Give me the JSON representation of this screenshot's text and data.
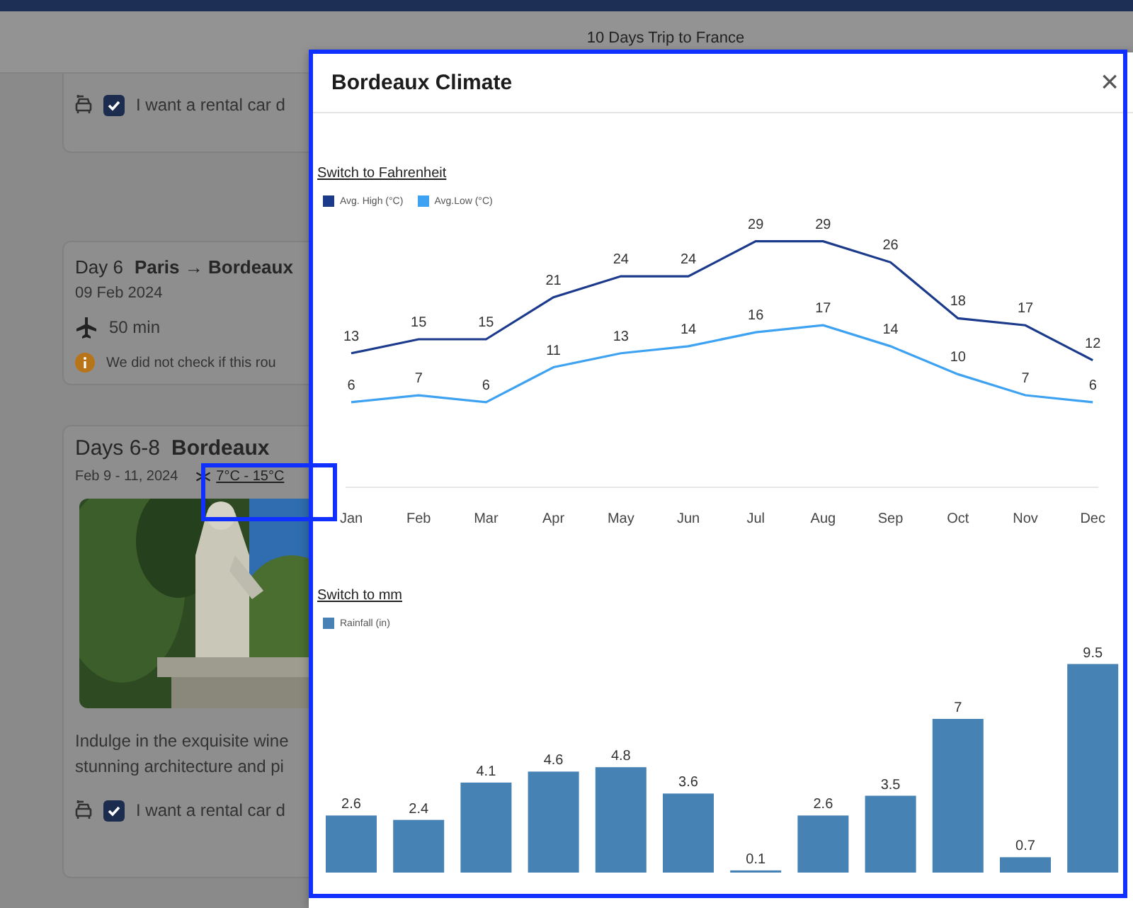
{
  "header": {
    "title": "10 Days Trip to France"
  },
  "cards": [
    {
      "kind": "rental",
      "rental": {
        "label": "I want a rental car d",
        "checked": true
      }
    },
    {
      "kind": "transfer",
      "day": "Day 6",
      "route": "Paris → Bordeaux",
      "date": "09 Feb 2024",
      "duration": "50 min",
      "notice": "We did not check if this rou"
    },
    {
      "kind": "stay",
      "day": "Days 6-8",
      "place": "Bordeaux",
      "date": "Feb 9 - 11, 2024",
      "temperature": "7°C - 15°C",
      "description": "Indulge in the exquisite wine stunning architecture and pi",
      "rental": {
        "label": "I want a rental car d",
        "checked": true
      }
    }
  ],
  "modal": {
    "title": "Bordeaux Climate",
    "close": "×",
    "temperature": {
      "switch_link": "Switch to Fahrenheit",
      "chart_data": {
        "type": "line",
        "legend": "top",
        "categories": [
          "Jan",
          "Feb",
          "Mar",
          "Apr",
          "May",
          "Jun",
          "Jul",
          "Aug",
          "Sep",
          "Oct",
          "Nov",
          "Dec"
        ],
        "data_labels": true,
        "series": [
          {
            "name": "Avg. High (°C)",
            "color": "#1b3a8c",
            "values": [
              13,
              15,
              15,
              21,
              24,
              24,
              29,
              29,
              26,
              18,
              17,
              12
            ]
          },
          {
            "name": "Avg.Low (°C)",
            "color": "#3ea2f2",
            "values": [
              6,
              7,
              6,
              11,
              13,
              14,
              16,
              17,
              14,
              10,
              7,
              6
            ]
          }
        ]
      }
    },
    "rainfall": {
      "switch_link": "Switch to mm",
      "chart_data": {
        "type": "bar",
        "legend": "top",
        "data_labels": true,
        "series": [
          {
            "name": "Rainfall (in)",
            "color": "#4682b4",
            "values": [
              2.6,
              2.4,
              4.1,
              4.6,
              4.8,
              3.6,
              0.1,
              2.6,
              3.5,
              7,
              0.7,
              9.5
            ]
          }
        ]
      }
    }
  }
}
